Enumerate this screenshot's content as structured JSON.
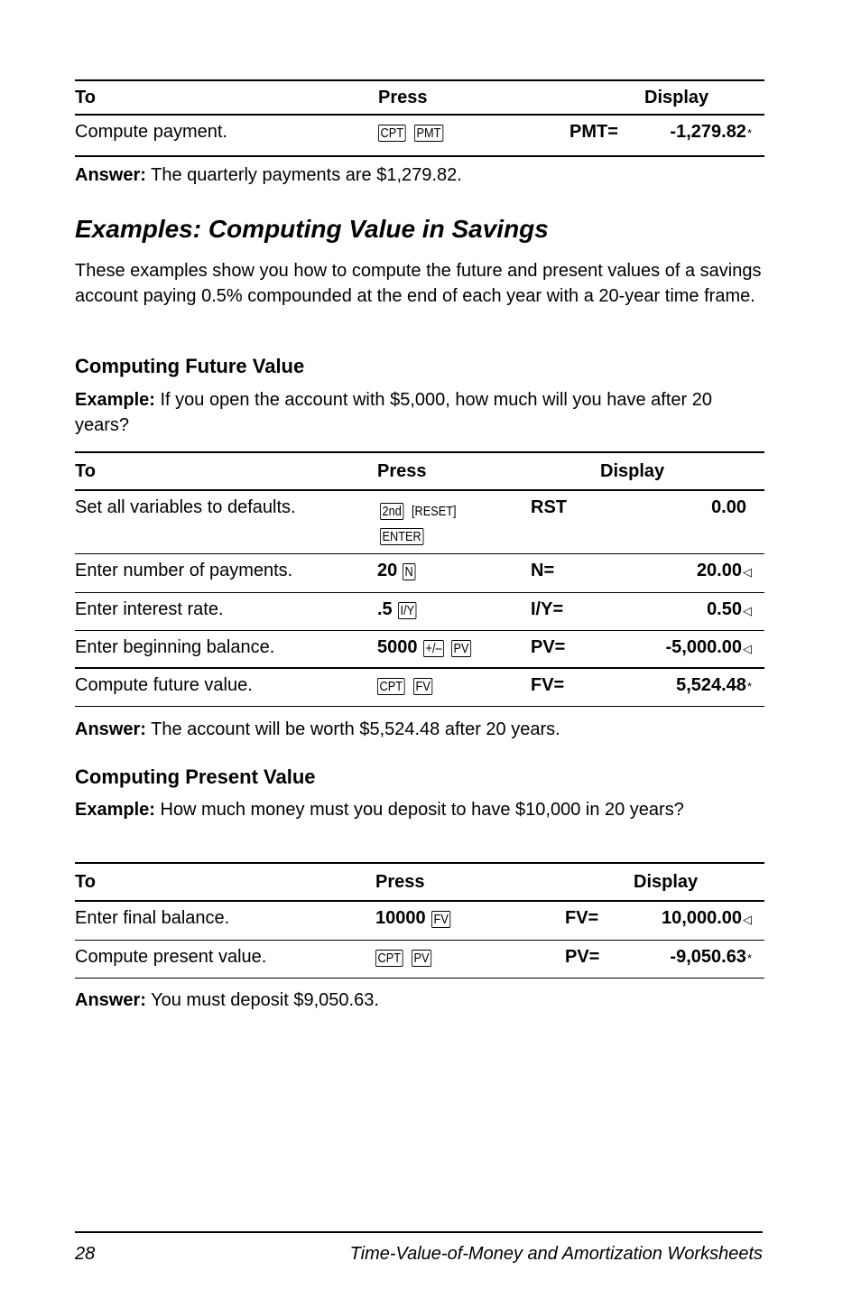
{
  "table1": {
    "headers": {
      "to": "To",
      "press": "Press",
      "display": "Display"
    },
    "rows": [
      {
        "to": "Compute payment.",
        "keys": [
          "CPT",
          "PMT"
        ],
        "label": "PMT=",
        "value": "-1,279.82",
        "mark": "*"
      }
    ]
  },
  "answer1": {
    "label": "Answer:",
    "text": " The quarterly payments are $1,279.82."
  },
  "section": {
    "title": "Examples: Computing Value in Savings",
    "intro": "These examples show you how to compute the future and present values of a savings account paying 0.5% compounded at the end of each year with a 20-year time frame."
  },
  "future": {
    "heading": "Computing Future Value",
    "example_label": "Example:",
    "example_text": " If you open the account with $5,000, how much will you have after 20 years?",
    "table": {
      "headers": {
        "to": "To",
        "press": "Press",
        "display": "Display"
      },
      "rows": [
        {
          "to": "Set all variables to defaults.",
          "keys": [
            "2nd",
            "[RESET]",
            "ENTER"
          ],
          "label": "RST",
          "value": "0.00",
          "mark": ""
        },
        {
          "to": "Enter number of payments.",
          "num": "20",
          "keys": [
            "N"
          ],
          "label": "N=",
          "value": "20.00",
          "mark": "◁"
        },
        {
          "to": "Enter interest rate.",
          "num": ".5",
          "keys": [
            "I/Y"
          ],
          "label": "I/Y=",
          "value": "0.50",
          "mark": "◁"
        },
        {
          "to": "Enter beginning balance.",
          "num": "5000",
          "keys": [
            "+/–",
            "PV"
          ],
          "label": "PV=",
          "value": "-5,000.00",
          "mark": "◁"
        },
        {
          "to": "Compute future value.",
          "keys": [
            "CPT",
            "FV"
          ],
          "label": "FV=",
          "value": "5,524.48",
          "mark": "*"
        }
      ]
    },
    "answer_label": "Answer:",
    "answer_text": " The account will be worth $5,524.48 after 20 years."
  },
  "present": {
    "heading": "Computing Present Value",
    "example_label": "Example:",
    "example_text": " How much money must you deposit to have $10,000 in 20 years?",
    "table": {
      "headers": {
        "to": "To",
        "press": "Press",
        "display": "Display"
      },
      "rows": [
        {
          "to": "Enter final balance.",
          "num": "10000",
          "keys": [
            "FV"
          ],
          "label": "FV=",
          "value": "10,000.00",
          "mark": "◁"
        },
        {
          "to": "Compute present value.",
          "keys": [
            "CPT",
            "PV"
          ],
          "label": "PV=",
          "value": "-9,050.63",
          "mark": "*"
        }
      ]
    },
    "answer_label": "Answer:",
    "answer_text": " You must deposit $9,050.63."
  },
  "footer": {
    "page_number": "28",
    "chapter_title": "Time-Value-of-Money and Amortization Worksheets"
  }
}
